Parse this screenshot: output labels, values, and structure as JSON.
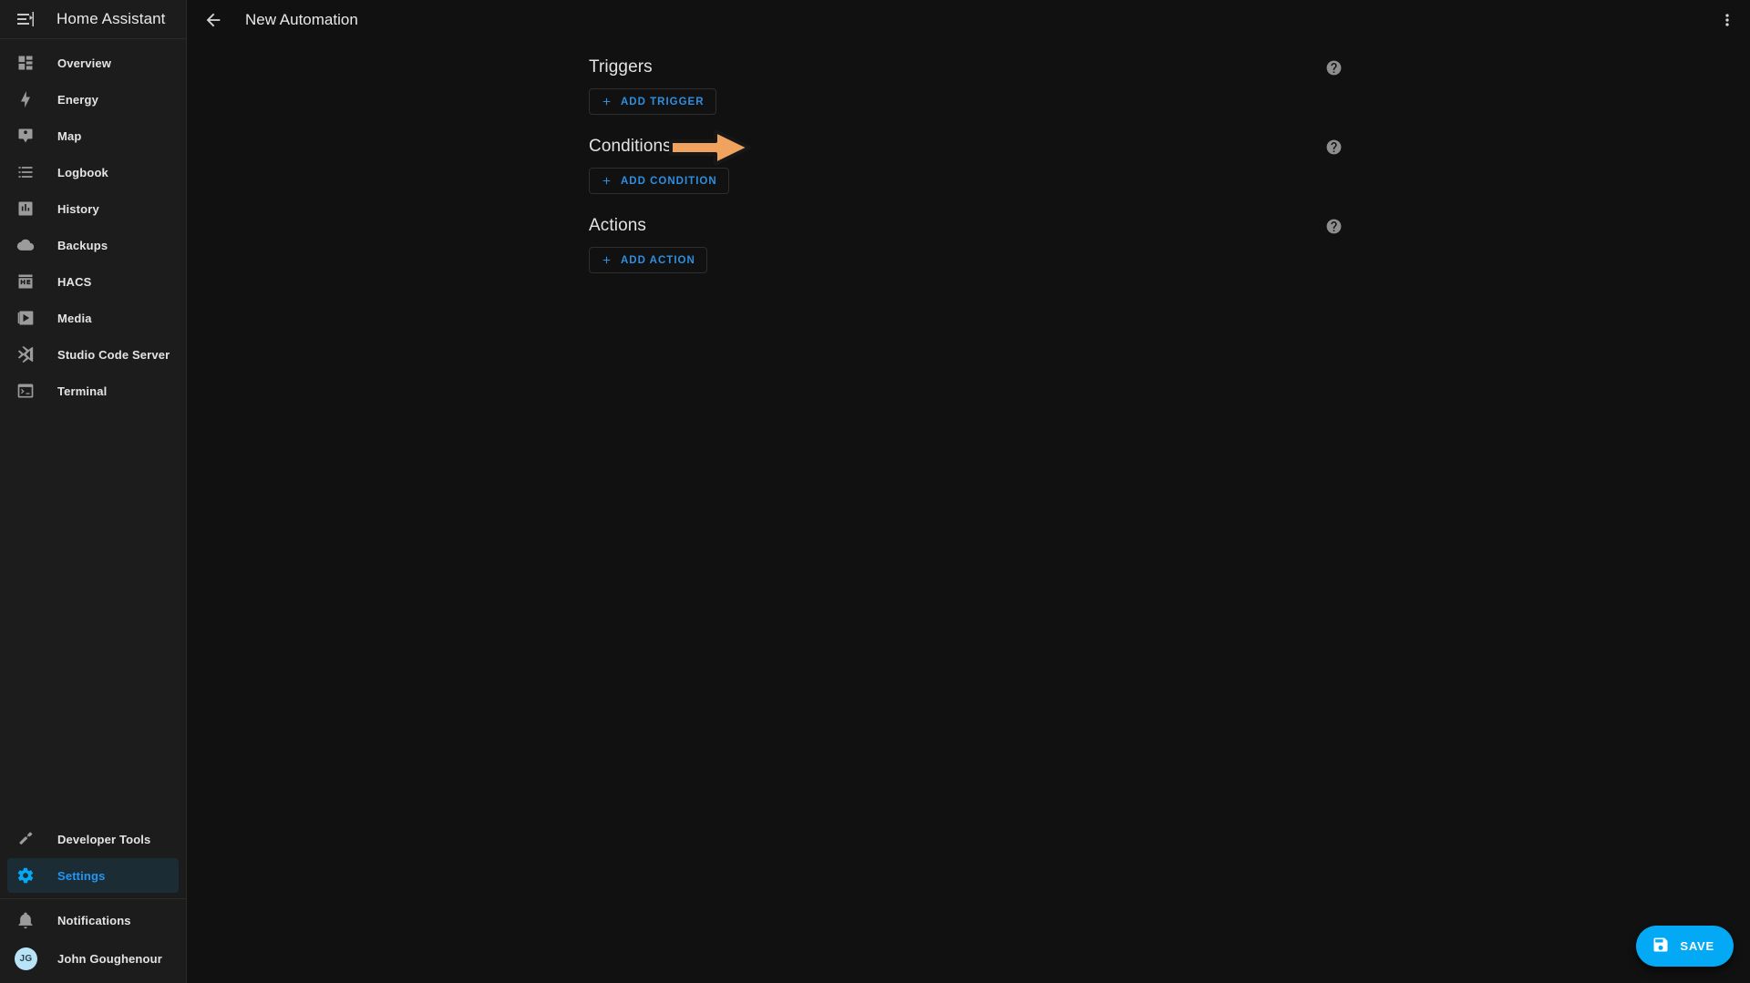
{
  "app": {
    "brand": "Home Assistant",
    "accent_color": "#03a9f4",
    "link_color": "#2e8fe0",
    "sidebar_bg": "#1c1c1c",
    "content_bg": "#111111",
    "annotation_arrow_color": "#f0a35e"
  },
  "sidebar": {
    "menu_toggle_name": "menu-open-icon",
    "items": [
      {
        "label": "Overview",
        "icon": "view-dashboard-icon",
        "selected": false
      },
      {
        "label": "Energy",
        "icon": "lightning-bolt-icon",
        "selected": false
      },
      {
        "label": "Map",
        "icon": "map-marker-account-icon",
        "selected": false
      },
      {
        "label": "Logbook",
        "icon": "format-list-bulleted-icon",
        "selected": false
      },
      {
        "label": "History",
        "icon": "chart-box-icon",
        "selected": false
      },
      {
        "label": "Backups",
        "icon": "cloud-icon",
        "selected": false
      },
      {
        "label": "HACS",
        "icon": "hacs-icon",
        "selected": false
      },
      {
        "label": "Media",
        "icon": "play-box-icon",
        "selected": false
      },
      {
        "label": "Studio Code Server",
        "icon": "vscode-icon",
        "selected": false
      },
      {
        "label": "Terminal",
        "icon": "console-icon",
        "selected": false
      }
    ],
    "bottom_items": [
      {
        "label": "Developer Tools",
        "icon": "hammer-icon",
        "selected": false
      },
      {
        "label": "Settings",
        "icon": "cog-icon",
        "selected": true
      }
    ],
    "footer_items": [
      {
        "label": "Notifications",
        "icon": "bell-outline-icon"
      }
    ],
    "profile": {
      "name": "John Goughenour",
      "initials": "JG"
    }
  },
  "toolbar": {
    "back_label": "back-arrow-icon",
    "title": "New Automation",
    "overflow_label": "dots-vertical-icon"
  },
  "editor": {
    "sections": [
      {
        "title": "Triggers",
        "add_label": "ADD TRIGGER",
        "help_label": "help-circle-icon"
      },
      {
        "title": "Conditions",
        "add_label": "ADD CONDITION",
        "help_label": "help-circle-icon"
      },
      {
        "title": "Actions",
        "add_label": "ADD ACTION",
        "help_label": "help-circle-icon"
      }
    ]
  },
  "fab": {
    "label": "SAVE",
    "icon": "content-save-icon"
  }
}
